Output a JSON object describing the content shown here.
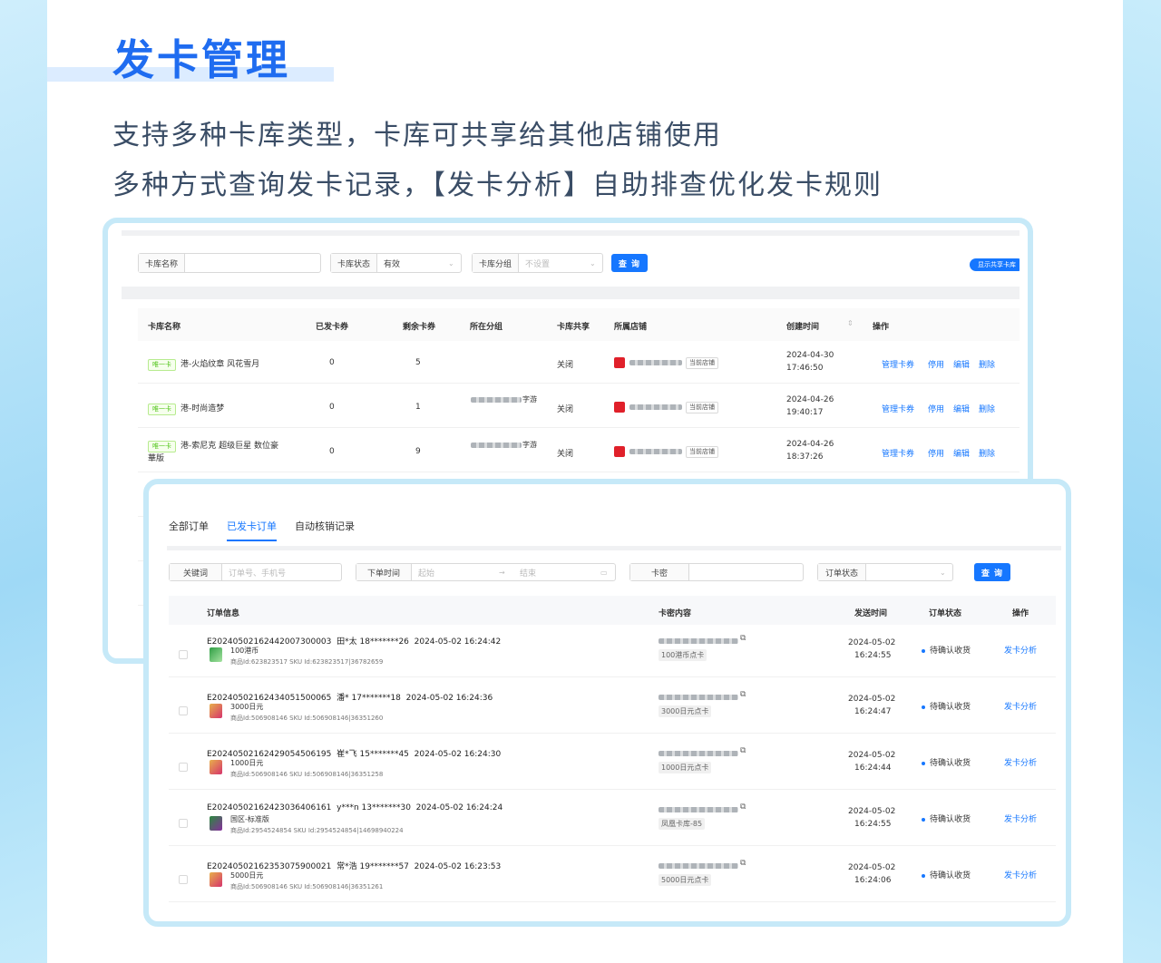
{
  "header": {
    "title": "发卡管理",
    "line1": "支持多种卡库类型，卡库可共享给其他店铺使用",
    "line2": "多种方式查询发卡记录，【发卡分析】自助排查优化发卡规则"
  },
  "colors": {
    "accent": "#1f6cf0",
    "button": "#1677ff",
    "tag_green": "#52c41a"
  },
  "library": {
    "filters": {
      "name_label": "卡库名称",
      "name_value": "",
      "status_label": "卡库状态",
      "status_value": "有效",
      "group_label": "卡库分组",
      "group_placeholder": "不设置",
      "query": "查 询",
      "share_toggle": "显示共享卡库"
    },
    "columns": [
      "卡库名称",
      "已发卡券",
      "剩余卡券",
      "所在分组",
      "卡库共享",
      "所属店铺",
      "创建时间",
      "操作"
    ],
    "rows": [
      {
        "tag": "唯一卡",
        "name": "港-火焰纹章 风花雪月",
        "issued": "0",
        "remaining": "5",
        "group": "",
        "share": "关闭",
        "current": "当前店铺",
        "date": "2024-04-30",
        "time": "17:46:50"
      },
      {
        "tag": "唯一卡",
        "name": "港-时尚造梦",
        "issued": "0",
        "remaining": "1",
        "group": "字游",
        "share": "关闭",
        "current": "当前店铺",
        "date": "2024-04-26",
        "time": "19:40:17"
      },
      {
        "tag": "唯一卡",
        "name": "港-索尼克 超级巨星 数位豪",
        "name2": "華版",
        "issued": "0",
        "remaining": "9",
        "group": "字游",
        "share": "关闭",
        "current": "当前店铺",
        "date": "2024-04-26",
        "time": "18:37:26"
      }
    ],
    "actions": [
      "管理卡券",
      "停用",
      "编辑",
      "删除"
    ]
  },
  "orders": {
    "tabs": [
      "全部订单",
      "已发卡订单",
      "自动核销记录"
    ],
    "filters": {
      "keyword_label": "关键词",
      "keyword_placeholder": "订单号、手机号",
      "time_label": "下单时间",
      "time_start": "起始",
      "time_end": "结束",
      "card_label": "卡密",
      "status_label": "订单状态",
      "query": "查 询"
    },
    "columns": [
      "订单信息",
      "卡密内容",
      "发送时间",
      "订单状态",
      "操作"
    ],
    "rows": [
      {
        "id": "E20240502162442007300003",
        "buyer": "田*太 18*******26",
        "time": "2024-05-02 16:24:42",
        "product": "100港币",
        "meta": "商品Id:623823517  SKU Id:623823517|36782659",
        "card_tag": "100港币点卡",
        "send_date": "2024-05-02",
        "send_time": "16:24:55",
        "status": "待确认收货",
        "action": "发卡分析"
      },
      {
        "id": "E20240502162434051500065",
        "buyer": "潘* 17*******18",
        "time": "2024-05-02 16:24:36",
        "product": "3000日元",
        "meta": "商品Id:506908146  SKU Id:506908146|36351260",
        "card_tag": "3000日元点卡",
        "send_date": "2024-05-02",
        "send_time": "16:24:47",
        "status": "待确认收货",
        "action": "发卡分析"
      },
      {
        "id": "E20240502162429054506195",
        "buyer": "崔*飞 15*******45",
        "time": "2024-05-02 16:24:30",
        "product": "1000日元",
        "meta": "商品Id:506908146  SKU Id:506908146|36351258",
        "card_tag": "1000日元点卡",
        "send_date": "2024-05-02",
        "send_time": "16:24:44",
        "status": "待确认收货",
        "action": "发卡分析"
      },
      {
        "id": "E20240502162423036406161",
        "buyer": "y***n 13*******30",
        "time": "2024-05-02 16:24:24",
        "product": "国区-标准版",
        "meta": "商品Id:2954524854  SKU Id:2954524854|14698940224",
        "card_tag": "凤凰卡库-85",
        "send_date": "2024-05-02",
        "send_time": "16:24:55",
        "status": "待确认收货",
        "action": "发卡分析"
      },
      {
        "id": "E20240502162353075900021",
        "buyer": "常*浩 19*******57",
        "time": "2024-05-02 16:23:53",
        "product": "5000日元",
        "meta": "商品Id:506908146  SKU Id:506908146|36351261",
        "card_tag": "5000日元点卡",
        "send_date": "2024-05-02",
        "send_time": "16:24:06",
        "status": "待确认收货",
        "action": "发卡分析"
      }
    ]
  }
}
